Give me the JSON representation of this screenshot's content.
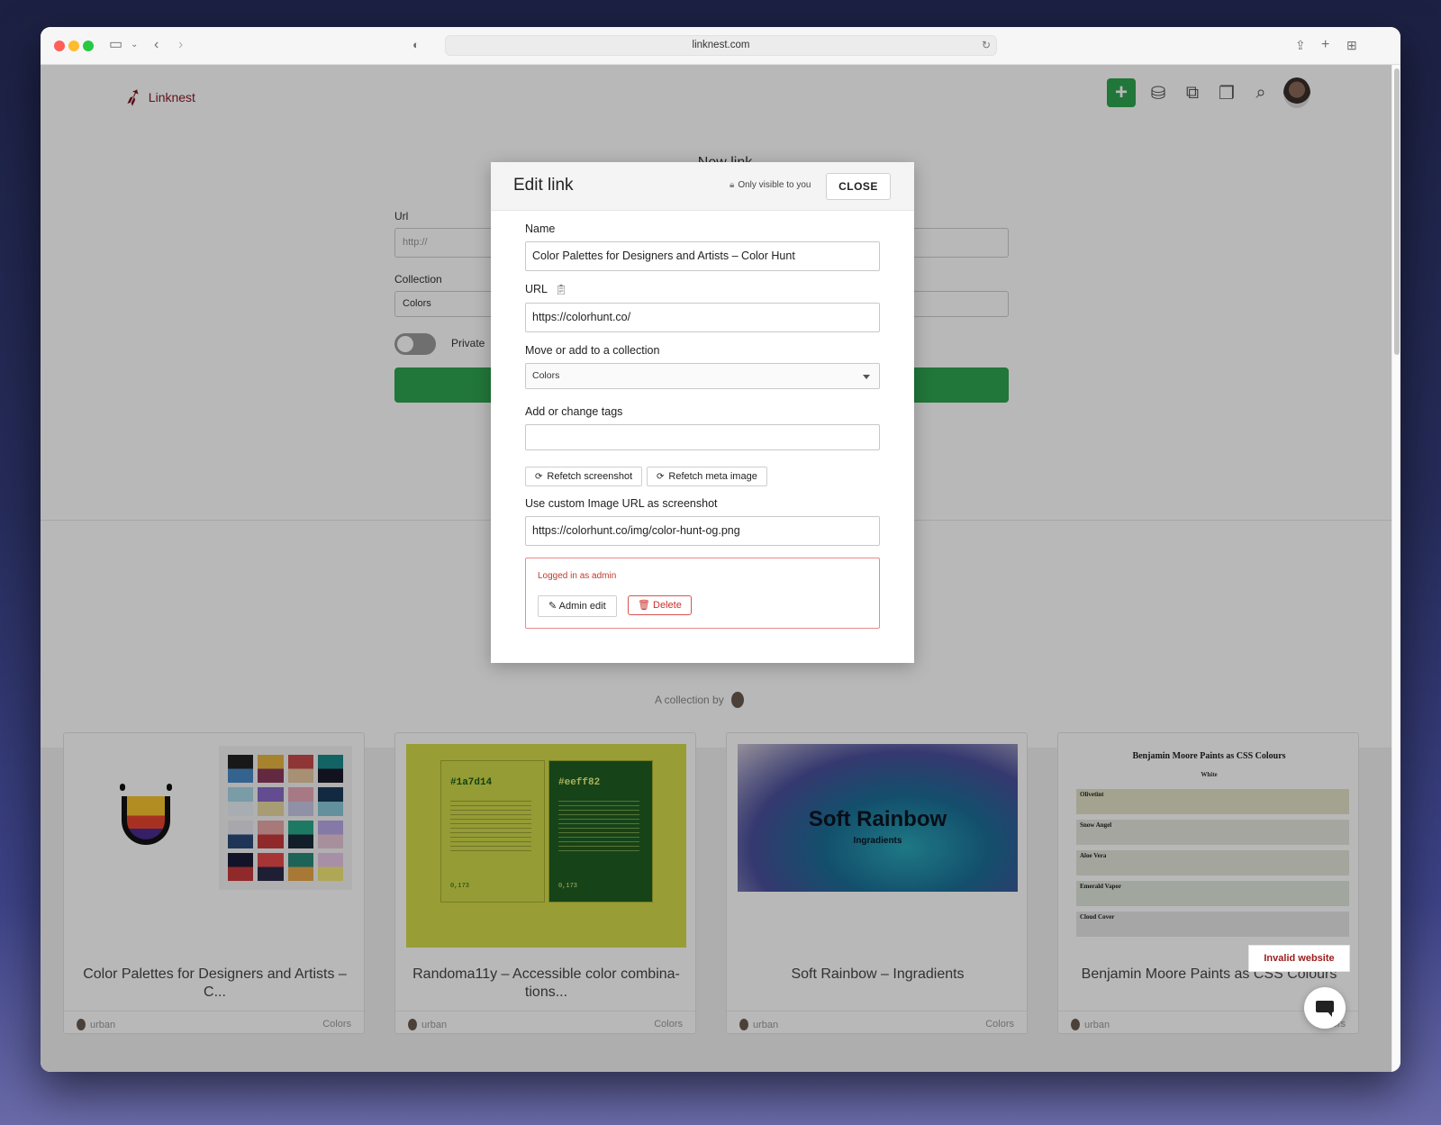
{
  "browser": {
    "url": "linknest.com"
  },
  "app": {
    "brand": "Linknest",
    "icons": [
      "add-link-icon",
      "cake-icon",
      "collections-add-icon",
      "collections-icon",
      "search-icon",
      "user-avatar"
    ]
  },
  "background_form": {
    "title": "New link",
    "url_label": "Url",
    "url_placeholder": "http://",
    "collection_label": "Collection",
    "collection_value": "Colors",
    "private_label": "Private",
    "collection_by": "A collection by"
  },
  "modal": {
    "title": "Edit link",
    "visibility": "Only visible to you",
    "close_label": "CLOSE",
    "name_label": "Name",
    "name_value": "Color Palettes for Designers and Artists – Color Hunt",
    "url_label": "URL",
    "url_value": "https://colorhunt.co/",
    "collection_label": "Move or add to a collection",
    "collection_value": "Colors",
    "tags_label": "Add or change tags",
    "tags_value": "",
    "refetch_screenshot": "Refetch screenshot",
    "refetch_meta": "Refetch meta image",
    "custom_image_label": "Use custom Image URL as screenshot",
    "custom_image_value": "https://colorhunt.co/img/color-hunt-og.png",
    "admin_note": "Logged in as admin",
    "admin_edit": "Admin edit",
    "delete_label": "Delete"
  },
  "cards": [
    {
      "title": "Color Palettes for Designers and Artists – C...",
      "user": "urban",
      "collection": "Colors"
    },
    {
      "title": "Randoma11y – Accessible color combina-tions...",
      "user": "urban",
      "collection": "Colors",
      "thumb_hex_1": "#1a7d14",
      "thumb_hex_2": "#eeff82",
      "thumb_num": "0,173"
    },
    {
      "title": "Soft Rainbow – Ingradients",
      "user": "urban",
      "collection": "Colors",
      "thumb_title": "Soft Rainbow",
      "thumb_sub": "Ingradients"
    },
    {
      "title": "Benjamin Moore Paints as CSS Colours",
      "user": "urban",
      "collection": "Colors",
      "thumb_title": "Benjamin Moore Paints as CSS Colours",
      "thumb_sub": "White",
      "swatches": [
        "Olivetint",
        "Snow Angel",
        "Aloe Vera",
        "Emerald Vapor",
        "Cloud Cover"
      ]
    }
  ],
  "invalid_badge": "Invalid website",
  "colors": {
    "accent_green": "#2ea44f",
    "danger": "#c9302c",
    "brand": "#8a1a2a"
  }
}
